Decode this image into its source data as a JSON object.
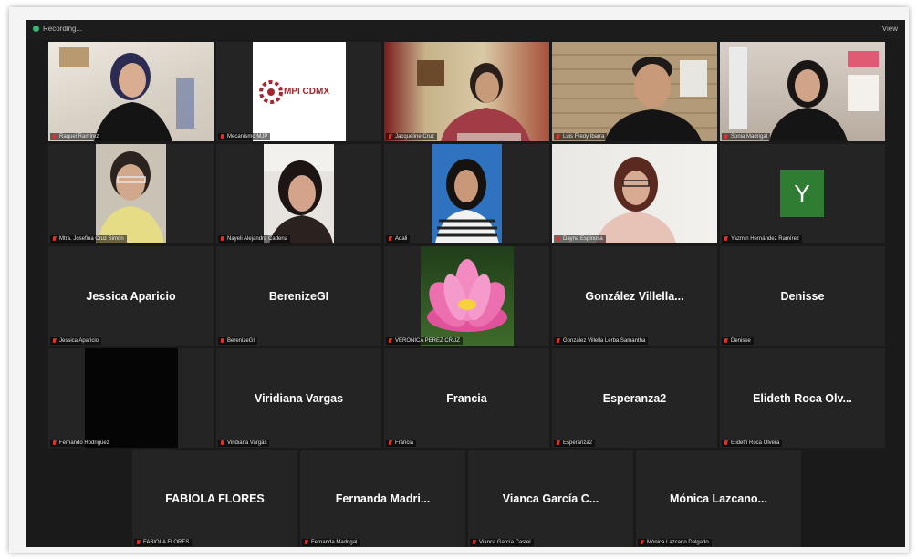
{
  "topbar": {
    "title": "Recording...",
    "view": "View"
  },
  "tiles": [
    {
      "display_name": "",
      "label": "Raquel Ramírez",
      "kind": "video"
    },
    {
      "display_name": "",
      "label": "Mecanismo MJP",
      "kind": "logo",
      "logo_text": "MPI CDMX"
    },
    {
      "display_name": "",
      "label": "Jacqueline Cruz",
      "kind": "video"
    },
    {
      "display_name": "",
      "label": "Luis Fredy Ibarra",
      "kind": "video",
      "active": true
    },
    {
      "display_name": "",
      "label": "Sonia Madrigal",
      "kind": "video"
    },
    {
      "display_name": "",
      "label": "Mtra. Josefina Cruz Simón",
      "kind": "video"
    },
    {
      "display_name": "",
      "label": "Nayeli Alejandra Cadena",
      "kind": "video"
    },
    {
      "display_name": "",
      "label": "Adali",
      "kind": "video"
    },
    {
      "display_name": "",
      "label": "Dayna Espinosa",
      "kind": "video"
    },
    {
      "display_name": "",
      "label": "Yazmin Hernández Ramírez",
      "kind": "avatar",
      "avatar_letter": "Y"
    },
    {
      "display_name": "Jessica Aparicio",
      "label": "Jessica Aparicio",
      "kind": "name"
    },
    {
      "display_name": "BerenizeGI",
      "label": "BerenizeGI",
      "kind": "name"
    },
    {
      "display_name": "",
      "label": "VERONICA PEREZ CRUZ",
      "kind": "flower"
    },
    {
      "display_name": "González Villella...",
      "label": "González Villella Lerba Samantha",
      "kind": "name"
    },
    {
      "display_name": "Denisse",
      "label": "Denisse",
      "kind": "name"
    },
    {
      "display_name": "",
      "label": "Fernando Rodriguez",
      "kind": "black"
    },
    {
      "display_name": "Viridiana Vargas",
      "label": "Viridiana Vargas",
      "kind": "name"
    },
    {
      "display_name": "Francia",
      "label": "Francia",
      "kind": "name"
    },
    {
      "display_name": "Esperanza2",
      "label": "Esperanza2",
      "kind": "name"
    },
    {
      "display_name": "Elideth Roca Olv...",
      "label": "Elideth Roca Olvera",
      "kind": "name"
    },
    {
      "display_name": "FABIOLA FLORES",
      "label": "FABIOLA FLORES",
      "kind": "name"
    },
    {
      "display_name": "Fernanda Madri...",
      "label": "Fernanda Madrigal",
      "kind": "name"
    },
    {
      "display_name": "Vianca García C...",
      "label": "Vianca García Castel",
      "kind": "name"
    },
    {
      "display_name": "Mónica Lazcano...",
      "label": "Mónica Lazcano Delgado",
      "kind": "name"
    }
  ],
  "colors": {
    "tile_bg": "#242424",
    "active_border": "#c8e23a",
    "avatar_bg": "#2f7d32",
    "muted_mic": "#dd3333"
  }
}
